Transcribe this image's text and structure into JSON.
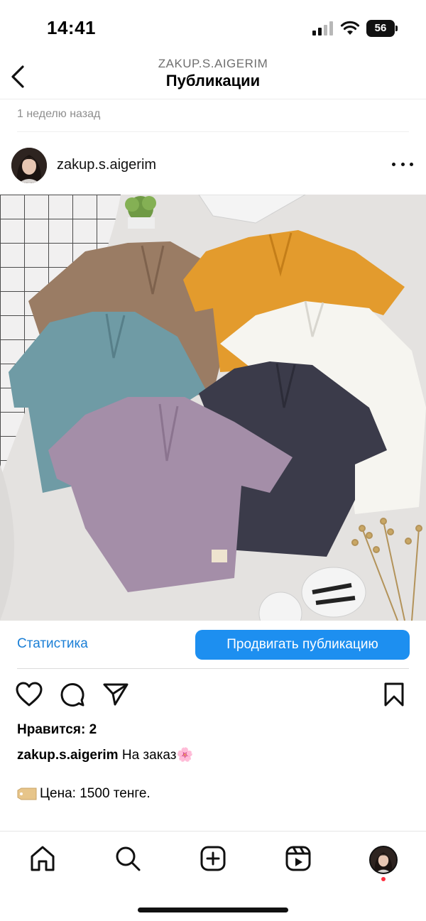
{
  "status_bar": {
    "time": "14:41",
    "battery": "56"
  },
  "header": {
    "subtitle": "ZAKUP.S.AIGERIM",
    "title": "Публикации"
  },
  "post": {
    "time_ago": "1 неделю назад",
    "username": "zakup.s.aigerim",
    "image_subject": "children's muslin t-shirts",
    "stats_label": "Статистика",
    "promote_label": "Продвигать публикацию",
    "likes": "Нравится: 2",
    "caption_user": "zakup.s.aigerim",
    "caption_text": "На заказ🌸",
    "price_text": "Цена: 1500 тенге."
  },
  "nav": {
    "items": [
      "home-icon",
      "search-icon",
      "create-icon",
      "reels-icon",
      "profile-avatar"
    ]
  },
  "colors": {
    "accent": "#1d8ff0",
    "link": "#1b7fd6",
    "notification_dot": "#ff3040"
  }
}
